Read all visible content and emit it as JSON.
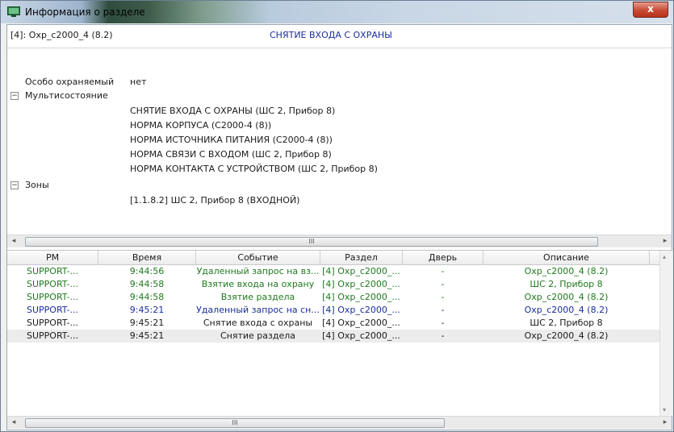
{
  "window": {
    "title": "Информация о разделе",
    "close_label": "x"
  },
  "header": {
    "partition_id": "[4]: Охр_с2000_4 (8.2)",
    "state": "СНЯТИЕ ВХОДА С ОХРАНЫ"
  },
  "properties": {
    "guarded_label": "Особо охраняемый",
    "guarded_value": "нет",
    "multistate_label": "Мультисостояние",
    "multistate_values": [
      "СНЯТИЕ ВХОДА С ОХРАНЫ (ШС 2, Прибор 8)",
      "НОРМА КОРПУСА (С2000-4 (8))",
      "НОРМА ИСТОЧНИКА ПИТАНИЯ (С2000-4 (8))",
      "НОРМА СВЯЗИ С ВХОДОМ (ШС 2, Прибор 8)",
      "НОРМА КОНТАКТА С УСТРОЙСТВОМ (ШС 2, Прибор 8)"
    ],
    "zones_label": "Зоны",
    "zones_values": [
      "[1.1.8.2] ШС 2, Прибор 8 (ВХОДНОЙ)"
    ],
    "toggle_glyph": "−"
  },
  "scroll": {
    "left_arrow": "◂",
    "right_arrow": "▸",
    "thumb_grip": "III"
  },
  "table": {
    "columns": [
      "РМ",
      "Время",
      "Событие",
      "Раздел",
      "Дверь",
      "Описание"
    ],
    "rows": [
      {
        "rm": "SUPPORT-...",
        "time": "9:44:56",
        "event": "Удаленный запрос на вз...",
        "partition": "[4] Охр_с2000_...",
        "door": "-",
        "desc": "Охр_с2000_4 (8.2)",
        "color": "#1f7a1f"
      },
      {
        "rm": "SUPPORT-...",
        "time": "9:44:58",
        "event": "Взятие входа на охрану",
        "partition": "[4] Охр_с2000_...",
        "door": "-",
        "desc": "ШС 2, Прибор 8",
        "color": "#1f7a1f"
      },
      {
        "rm": "SUPPORT-...",
        "time": "9:44:58",
        "event": "Взятие раздела",
        "partition": "[4] Охр_с2000_...",
        "door": "-",
        "desc": "Охр_с2000_4 (8.2)",
        "color": "#1f7a1f"
      },
      {
        "rm": "SUPPORT-...",
        "time": "9:45:21",
        "event": "Удаленный запрос на сн...",
        "partition": "[4] Охр_с2000_...",
        "door": "-",
        "desc": "Охр_с2000_4 (8.2)",
        "color": "#1a2f9c"
      },
      {
        "rm": "SUPPORT-...",
        "time": "9:45:21",
        "event": "Снятие входа с охраны",
        "partition": "[4] Охр_с2000_...",
        "door": "-",
        "desc": "ШС 2, Прибор 8",
        "color": "#1b1b1b"
      },
      {
        "rm": "SUPPORT-...",
        "time": "9:45:21",
        "event": "Снятие раздела",
        "partition": "[4] Охр_с2000_...",
        "door": "-",
        "desc": "Охр_с2000_4 (8.2)",
        "color": "#1b1b1b"
      }
    ],
    "selected_row": 5
  }
}
